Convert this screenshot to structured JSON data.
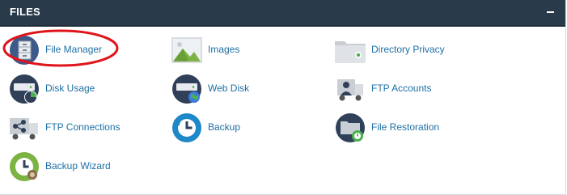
{
  "section": {
    "title": "FILES",
    "collapse_symbol": "-"
  },
  "items": [
    {
      "label": "File Manager",
      "icon": "file-manager-icon"
    },
    {
      "label": "Images",
      "icon": "images-icon"
    },
    {
      "label": "Directory Privacy",
      "icon": "directory-privacy-icon"
    },
    {
      "label": "Disk Usage",
      "icon": "disk-usage-icon"
    },
    {
      "label": "Web Disk",
      "icon": "web-disk-icon"
    },
    {
      "label": "FTP Accounts",
      "icon": "ftp-accounts-icon"
    },
    {
      "label": "FTP Connections",
      "icon": "ftp-connections-icon"
    },
    {
      "label": "Backup",
      "icon": "backup-icon"
    },
    {
      "label": "File Restoration",
      "icon": "file-restoration-icon"
    },
    {
      "label": "Backup Wizard",
      "icon": "backup-wizard-icon"
    }
  ],
  "colors": {
    "header_bg": "#293a4a",
    "link": "#1d6fa5",
    "highlight_ring": "#e0151b"
  }
}
